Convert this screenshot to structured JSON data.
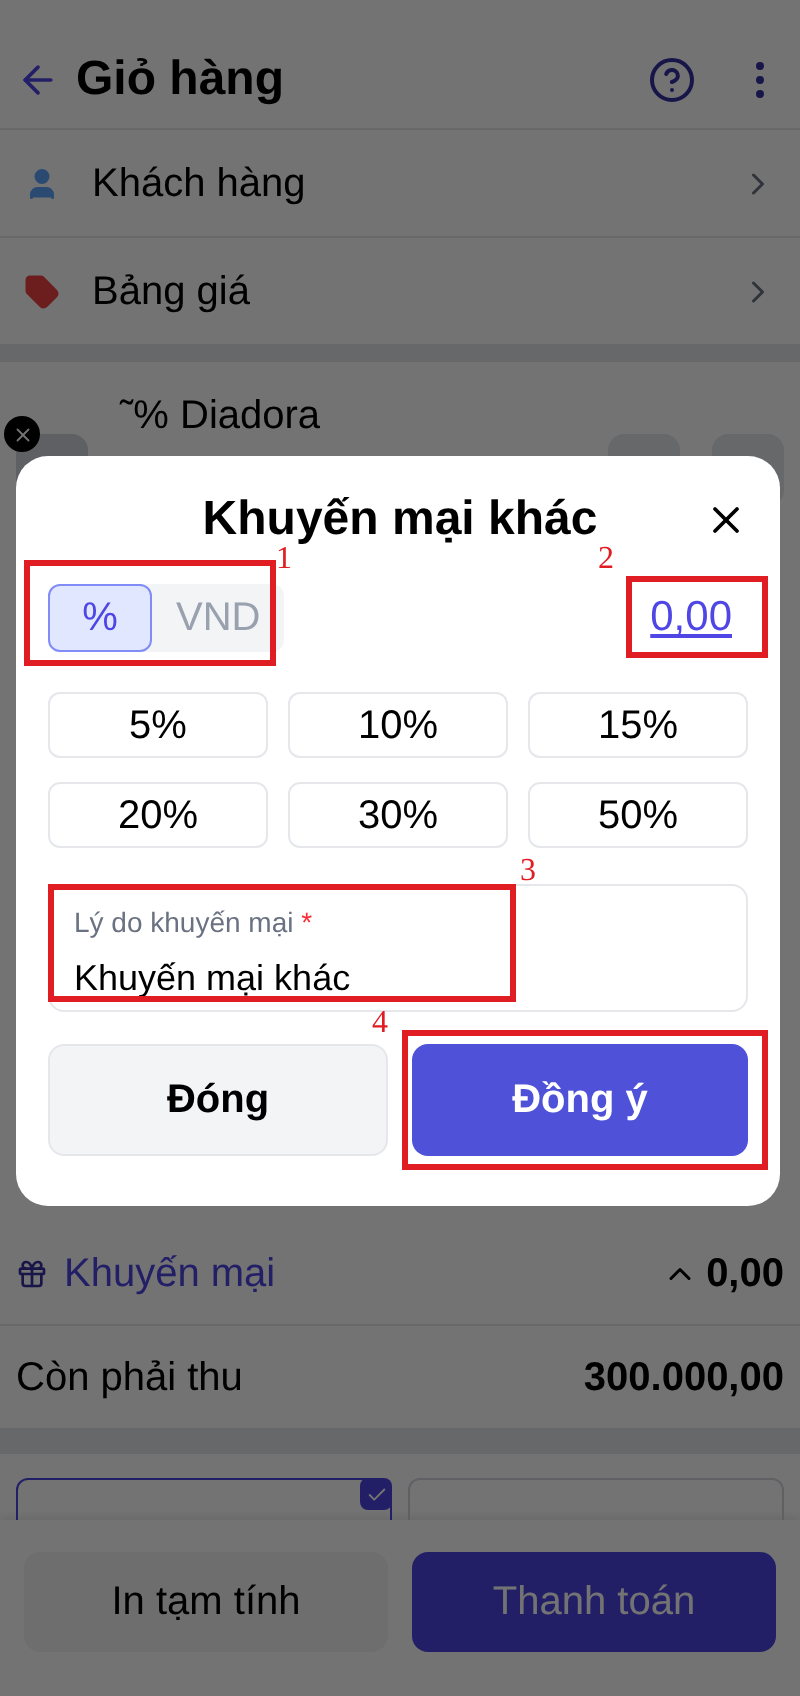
{
  "header": {
    "title": "Giỏ hàng"
  },
  "menu_rows": [
    {
      "kind": "customer",
      "label": "Khách hàng"
    },
    {
      "kind": "price",
      "label": "Bảng giá"
    }
  ],
  "product": {
    "name": "˜% Diadora"
  },
  "summary": [
    {
      "kind": "promo",
      "label": "Khuyến mại",
      "value": "0,00"
    },
    {
      "kind": "plain",
      "label": "Còn phải thu",
      "value": "300.000,00"
    }
  ],
  "payment_options": [
    {
      "selected": true
    },
    {
      "selected": false
    }
  ],
  "bottom_buttons": [
    {
      "kind": "secondary",
      "label": "In tạm tính"
    },
    {
      "kind": "primary",
      "label": "Thanh toán"
    }
  ],
  "dialog": {
    "title": "Khuyến mại khác",
    "units": [
      {
        "label": "%",
        "selected": true
      },
      {
        "label": "VND",
        "selected": false
      }
    ],
    "amount": "0,00",
    "presets": [
      "5%",
      "10%",
      "15%",
      "20%",
      "30%",
      "50%"
    ],
    "reason": {
      "label": "Lý do khuyến mại",
      "required_mark": "*",
      "value": "Khuyến mại khác"
    },
    "buttons": [
      {
        "kind": "secondary",
        "label": "Đóng"
      },
      {
        "kind": "primary",
        "label": "Đồng ý"
      }
    ]
  },
  "callouts": [
    "1",
    "2",
    "3",
    "4"
  ]
}
